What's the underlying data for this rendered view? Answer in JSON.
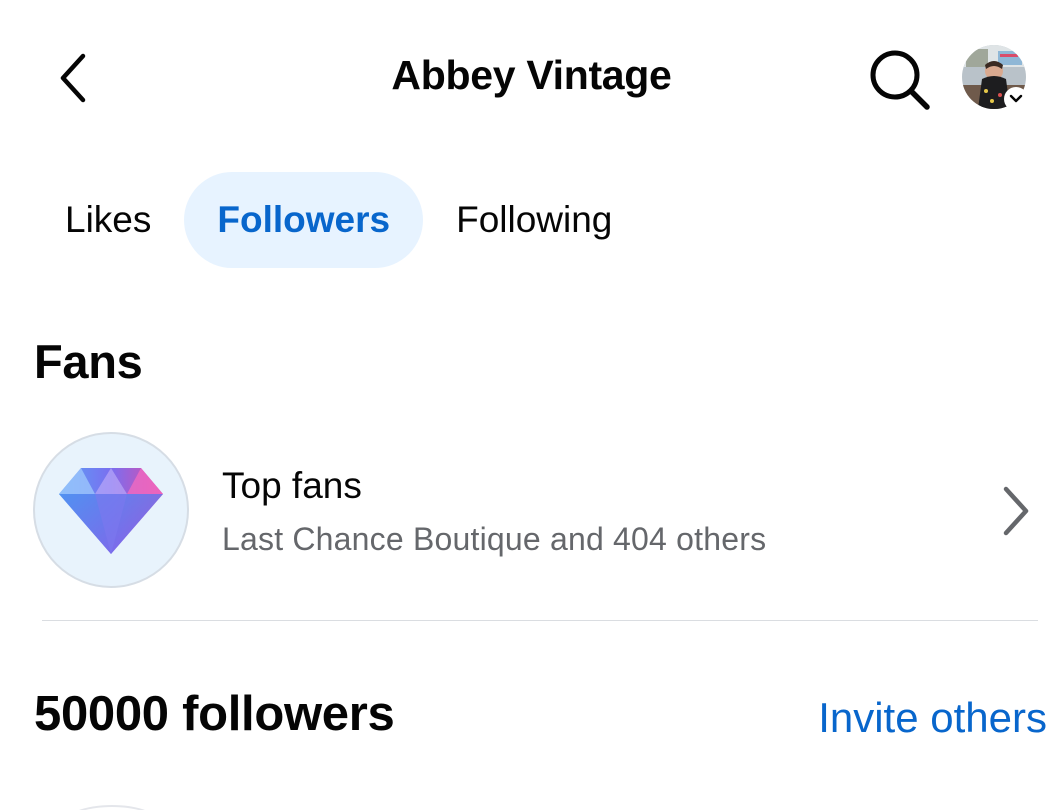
{
  "header": {
    "title": "Abbey Vintage",
    "back_icon": "chevron-left-icon",
    "search_icon": "search-icon",
    "avatar_menu_icon": "chevron-down-icon"
  },
  "tabs": [
    {
      "label": "Likes",
      "active": false
    },
    {
      "label": "Followers",
      "active": true
    },
    {
      "label": "Following",
      "active": false
    }
  ],
  "fans": {
    "section_title": "Fans",
    "top_fans": {
      "title": "Top fans",
      "subtitle": "Last Chance Boutique and 404 others",
      "icon": "diamond-icon"
    }
  },
  "followers": {
    "count_label": "50000 followers",
    "invite_label": "Invite others"
  },
  "colors": {
    "accent": "#0866cc",
    "active_tab_bg": "#e7f3ff",
    "secondary_text": "#65676b",
    "divider": "#dadde1"
  }
}
